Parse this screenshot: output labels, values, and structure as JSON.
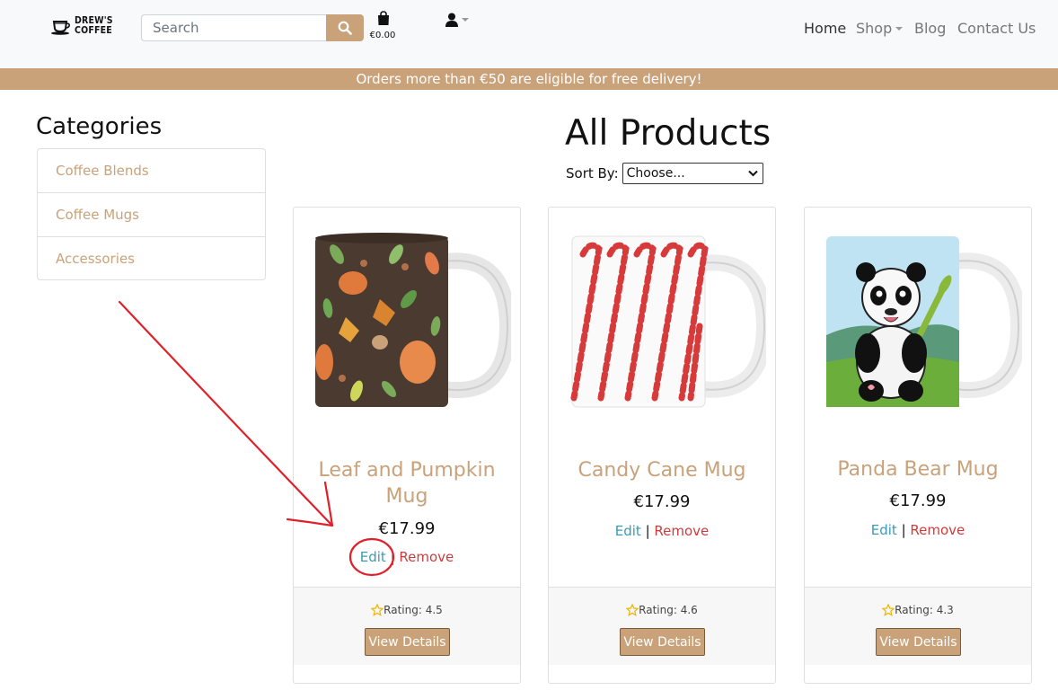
{
  "header": {
    "logo": {
      "line1": "DREW'S",
      "line2": "COFFEE"
    },
    "search": {
      "placeholder": "Search"
    },
    "cart_total": "€0.00",
    "nav": {
      "home": "Home",
      "shop": "Shop",
      "blog": "Blog",
      "contact": "Contact Us"
    }
  },
  "banner": {
    "text": "Orders more than €50 are eligible for free delivery!"
  },
  "categories": {
    "title": "Categories",
    "items": [
      {
        "label": "Coffee Blends"
      },
      {
        "label": "Coffee Mugs"
      },
      {
        "label": "Accessories"
      }
    ]
  },
  "main": {
    "title": "All Products",
    "sort": {
      "label": "Sort By:",
      "selected": "Choose..."
    }
  },
  "products": [
    {
      "name_line1": "Leaf and Pumpkin",
      "name_line2": "Mug",
      "price": "€17.99",
      "edit": "Edit",
      "separator": "|",
      "remove": "Remove",
      "rating": "Rating: 4.5",
      "details": "View Details"
    },
    {
      "name": "Candy Cane Mug",
      "price": "€17.99",
      "edit": "Edit",
      "separator": "|",
      "remove": "Remove",
      "rating": "Rating: 4.6",
      "details": "View Details"
    },
    {
      "name": "Panda Bear Mug",
      "price": "€17.99",
      "edit": "Edit",
      "separator": "|",
      "remove": "Remove",
      "rating": "Rating: 4.3",
      "details": "View Details"
    }
  ],
  "colors": {
    "accent": "#c9a27a",
    "edit_link": "#3a9bb0",
    "remove_link": "#d13a3a",
    "annotation": "#e0202a"
  }
}
